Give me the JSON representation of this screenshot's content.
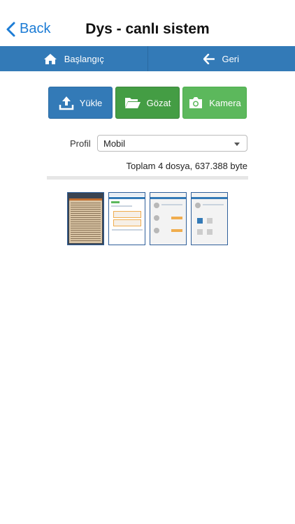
{
  "nav": {
    "back_label": "Back",
    "title": "Dys - canlı sistem"
  },
  "menu": {
    "home_label": "Başlangıç",
    "back_label": "Geri"
  },
  "actions": {
    "upload_label": "Yükle",
    "browse_label": "Gözat",
    "camera_label": "Kamera"
  },
  "profile": {
    "label": "Profil",
    "selected": "Mobil"
  },
  "summary": "Toplam 4 dosya, 637.388 byte",
  "colors": {
    "primary": "#337ab7",
    "success_dark": "#449d44",
    "success": "#5cb85c",
    "ios_blue": "#1c7cd5"
  },
  "icons": {
    "back": "chevron-left-icon",
    "home": "home-icon",
    "arrow": "arrow-left-icon",
    "upload": "upload-icon",
    "folder": "folder-open-icon",
    "camera": "camera-icon",
    "caret": "caret-down-icon"
  }
}
